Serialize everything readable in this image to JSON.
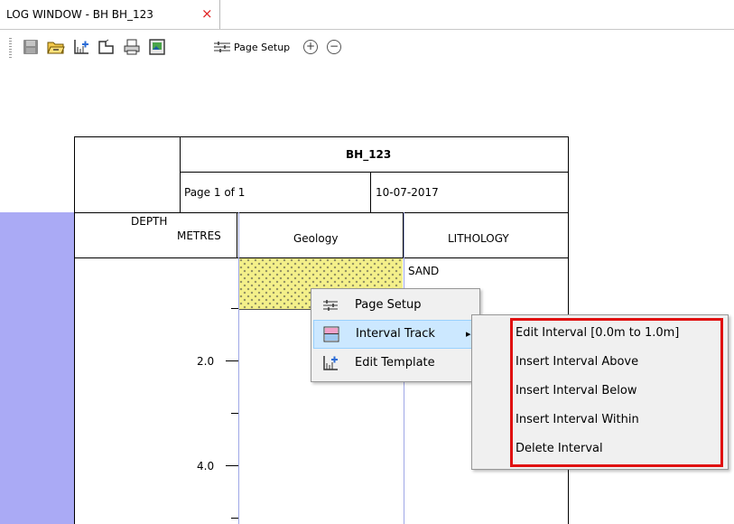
{
  "window": {
    "tab_title": "LOG WINDOW - BH BH_123",
    "tab_close_glyph": "×"
  },
  "toolbar": {
    "page_setup_label": "Page Setup",
    "zoom_in_glyph": "+",
    "zoom_out_glyph": "−",
    "icons": [
      "save-icon",
      "open-folder-icon",
      "edit-template-icon",
      "page-layout-icon",
      "print-icon",
      "image-export-icon",
      "page-setup-icon",
      "zoom-in-icon",
      "zoom-out-icon"
    ]
  },
  "log": {
    "borehole": "BH_123",
    "page": "Page 1 of 1",
    "date": "10-07-2017",
    "columns": {
      "depth_line1": "DEPTH",
      "depth_line2": "METRES",
      "geology": "Geology",
      "lithology": "LITHOLOGY"
    },
    "layers": [
      {
        "name": "SAND",
        "top_m": 0.0,
        "bottom_m": 1.0,
        "pattern": "sand-hatch"
      }
    ],
    "depth_labels": [
      "2.0",
      "4.0"
    ],
    "colors": {
      "depth_band": "#aaaaf5",
      "sand_fill": "#f4f08a",
      "track_border": "#9ea7e6"
    }
  },
  "context_menu": {
    "items": [
      {
        "label": "Page Setup",
        "icon": "page-setup-icon"
      },
      {
        "label": "Interval Track",
        "icon": "interval-track-icon",
        "submenu_arrow": "▸"
      },
      {
        "label": "Edit Template",
        "icon": "edit-template-icon"
      }
    ]
  },
  "submenu": {
    "items": [
      "Edit Interval [0.0m to 1.0m]",
      "Insert Interval Above",
      "Insert Interval Below",
      "Insert Interval Within",
      "Delete Interval"
    ],
    "highlight_color": "#e01010"
  }
}
